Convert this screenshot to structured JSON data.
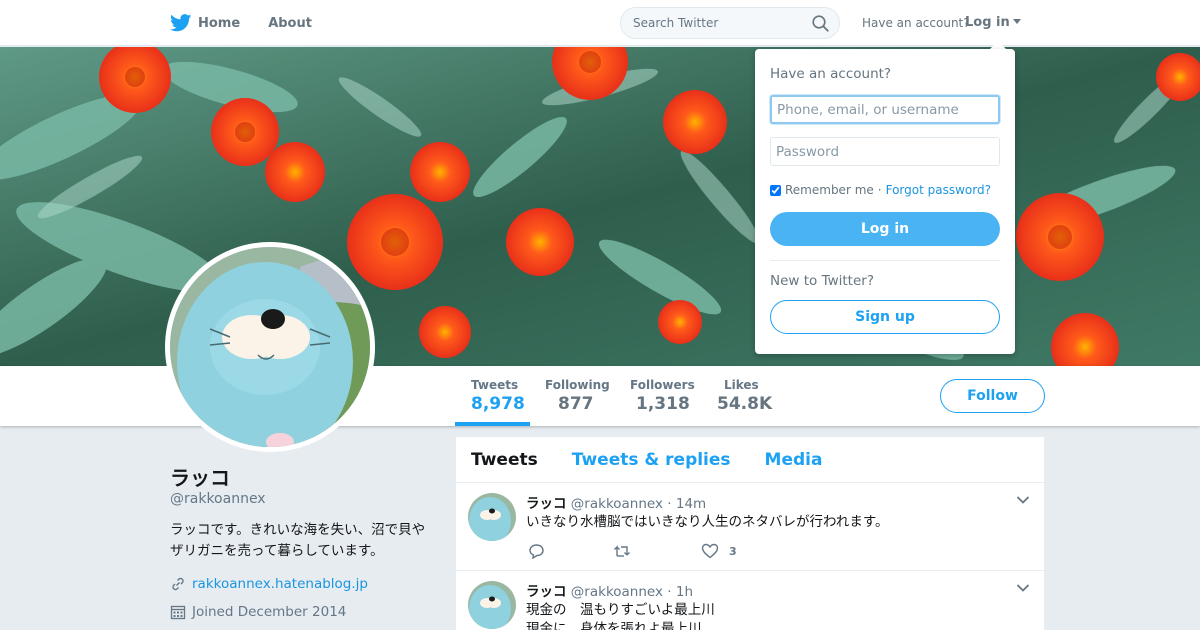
{
  "nav": {
    "home_label": "Home",
    "about_label": "About",
    "search_placeholder": "Search Twitter",
    "have_account_label": "Have an account?",
    "login_label": "Log in"
  },
  "profile": {
    "name": "ラッコ",
    "handle": "@rakkoannex",
    "bio": "ラッコです。きれいな海を失い、沼で貝やザリガニを売って暮らしています。",
    "link": "rakkoannex.hatenablog.jp",
    "joined": "Joined December 2014",
    "follow_label": "Follow",
    "stats": [
      {
        "label": "Tweets",
        "value": "8,978"
      },
      {
        "label": "Following",
        "value": "877"
      },
      {
        "label": "Followers",
        "value": "1,318"
      },
      {
        "label": "Likes",
        "value": "54.8K"
      }
    ]
  },
  "timeline": {
    "tabs": [
      "Tweets",
      "Tweets & replies",
      "Media"
    ],
    "tweets": [
      {
        "name": "ラッコ",
        "handle": "@rakkoannex",
        "time": "· 14m",
        "text_line1": "いきなり水槽脳ではいきなり人生のネタバレが行われます。",
        "text_line2": "",
        "likes": "3"
      },
      {
        "name": "ラッコ",
        "handle": "@rakkoannex",
        "time": "· 1h",
        "text_line1": "現金の　温もりすごいよ最上川",
        "text_line2": "現金に　身体を張れよ最上川",
        "likes": ""
      }
    ]
  },
  "login_dropdown": {
    "title": "Have an account?",
    "username_placeholder": "Phone, email, or username",
    "password_placeholder": "Password",
    "remember_label": "Remember me",
    "separator": "·",
    "forgot_label": "Forgot password?",
    "login_button": "Log in",
    "new_label": "New to Twitter?",
    "signup_button": "Sign up"
  },
  "colors": {
    "accent": "#1da1f2",
    "login_button": "#4ab3f4",
    "background": "#e6ecf0"
  }
}
